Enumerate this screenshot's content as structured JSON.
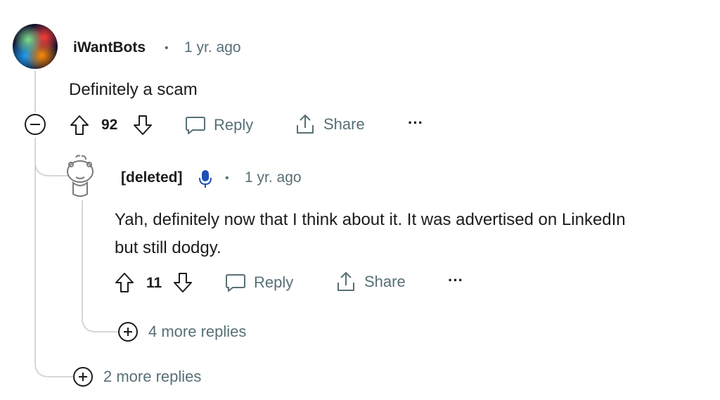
{
  "parent_comment": {
    "username": "iWantBots",
    "separator": "•",
    "timestamp": "1 yr. ago",
    "body": "Definitely a scam",
    "vote_count": "92",
    "reply_label": "Reply",
    "share_label": "Share",
    "more_label": "···",
    "more_replies_label": "2 more replies"
  },
  "child_comment": {
    "username": "[deleted]",
    "separator": "•",
    "timestamp": "1 yr. ago",
    "body_line1": "Yah, definitely now that I think about it. It was advertised on LinkedIn",
    "body_line2": "but still dodgy.",
    "vote_count": "11",
    "reply_label": "Reply",
    "share_label": "Share",
    "more_label": "···",
    "more_replies_label": "4 more replies"
  },
  "colors": {
    "text": "#1c1c1c",
    "muted": "#576f76",
    "thread_line": "#d4d7d9",
    "mic_icon": "#1f4fb3"
  },
  "icons": [
    "collapse-icon",
    "upvote-icon",
    "downvote-icon",
    "comment-icon",
    "share-icon",
    "more-icon",
    "microphone-icon",
    "expand-icon"
  ]
}
